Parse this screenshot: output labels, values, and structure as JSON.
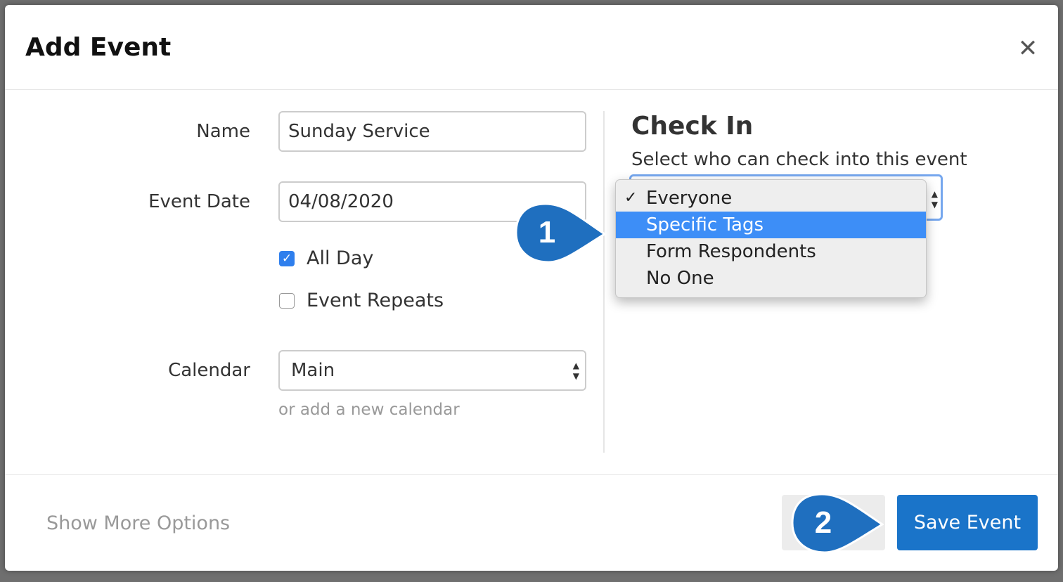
{
  "dialog": {
    "title": "Add Event",
    "close_glyph": "✕"
  },
  "form": {
    "name_label": "Name",
    "name_value": "Sunday Service",
    "date_label": "Event Date",
    "date_value": "04/08/2020",
    "all_day_label": "All Day",
    "all_day_checked": true,
    "repeats_label": "Event Repeats",
    "repeats_checked": false,
    "calendar_label": "Calendar",
    "calendar_value": "Main",
    "add_calendar_link": "or add a new calendar"
  },
  "check_in": {
    "title": "Check In",
    "subtitle": "Select who can check into this event",
    "options": [
      {
        "label": "Everyone",
        "selected": true,
        "highlighted": false
      },
      {
        "label": "Specific Tags",
        "selected": false,
        "highlighted": true
      },
      {
        "label": "Form Respondents",
        "selected": false,
        "highlighted": false
      },
      {
        "label": "No One",
        "selected": false,
        "highlighted": false
      }
    ],
    "check_glyph": "✓"
  },
  "footer": {
    "more_options": "Show More Options",
    "save_label": "Save Event"
  },
  "callouts": [
    "1",
    "2"
  ],
  "colors": {
    "primary": "#1a74c9",
    "highlight": "#3d8ef7",
    "callout": "#1f6fbf"
  },
  "icons": {
    "close": "close-icon",
    "check": "checkmark-icon",
    "select_arrows": "select-arrows-icon"
  }
}
